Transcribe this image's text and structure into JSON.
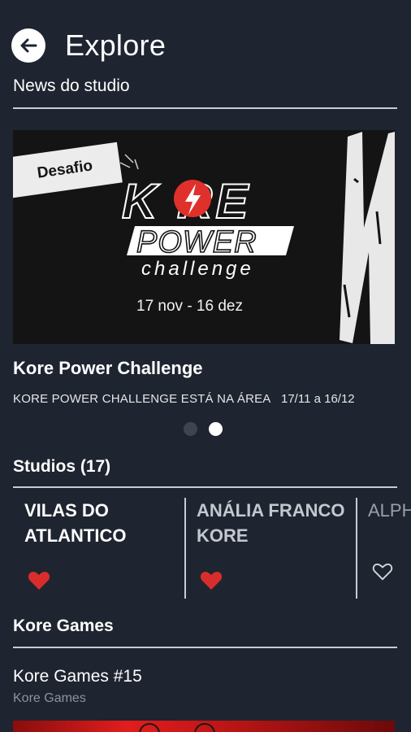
{
  "header": {
    "title": "Explore"
  },
  "news": {
    "section_label": "News do studio",
    "banner": {
      "tag": "Desafio",
      "logo_line1": "K RE",
      "logo_line2": "POWER",
      "logo_line3": "challenge",
      "date_range": "17 nov - 16 dez"
    },
    "title": "Kore Power Challenge",
    "subtitle": "KORE POWER CHALLENGE ESTÁ NA ÁREA",
    "date": "17/11 a 16/12",
    "pager": {
      "count": 2,
      "active_index": 1
    }
  },
  "studios": {
    "title": "Studios (17)",
    "items": [
      {
        "name_line1": "VILAS DO",
        "name_line2": "ATLANTICO",
        "favorite": true
      },
      {
        "name_line1": "ANÁLIA FRANCO",
        "name_line2": "KORE",
        "favorite": true
      },
      {
        "name_line1": "ALPHA",
        "name_line2": "",
        "favorite": false
      }
    ]
  },
  "games": {
    "title": "Kore Games",
    "items": [
      {
        "title": "Kore Games #15",
        "subtitle": "Kore Games"
      }
    ]
  },
  "colors": {
    "background": "#1e2430",
    "accent_red": "#e0302b",
    "heart_red": "#d92d2d",
    "muted_text": "#8e939c"
  }
}
